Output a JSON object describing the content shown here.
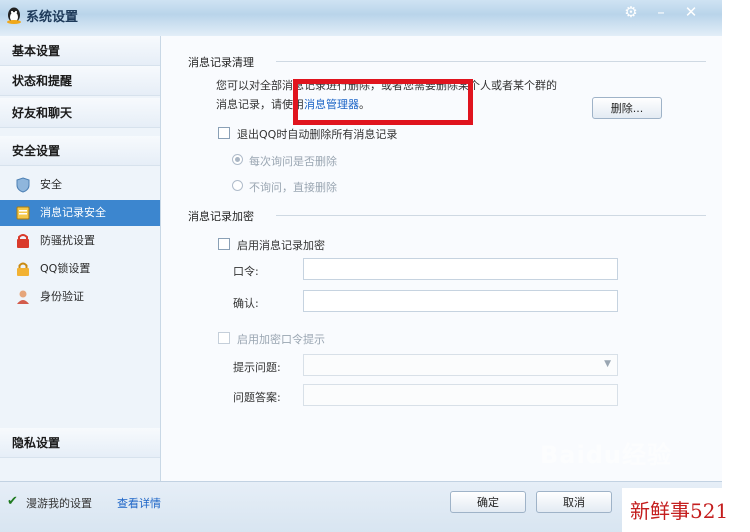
{
  "window": {
    "title": "系统设置",
    "controls": [
      "gear-icon",
      "minimize-icon",
      "close-icon"
    ]
  },
  "sidebar": {
    "categories": [
      {
        "label": "基本设置"
      },
      {
        "label": "状态和提醒"
      },
      {
        "label": "好友和聊天"
      },
      {
        "label": "安全设置"
      }
    ],
    "security_items": [
      {
        "label": "安全",
        "icon": "shield-icon"
      },
      {
        "label": "消息记录安全",
        "icon": "message-record-icon",
        "selected": true
      },
      {
        "label": "防骚扰设置",
        "icon": "anti-harass-icon"
      },
      {
        "label": "QQ锁设置",
        "icon": "lock-icon"
      },
      {
        "label": "身份验证",
        "icon": "user-verify-icon"
      }
    ],
    "privacy": {
      "label": "隐私设置"
    }
  },
  "cleanup": {
    "title": "消息记录清理",
    "desc_line1": "您可以对全部消息记录进行删除，或者您需要删除某个人或者某个群的",
    "desc_line2_prefix": "消息记录，请使用",
    "desc_link": "消息管理器",
    "desc_line2_suffix": "。",
    "delete_button": "删除...",
    "auto_delete_checkbox": {
      "label": "退出QQ时自动删除所有消息记录",
      "checked": false
    },
    "radio_ask": {
      "label": "每次询问是否删除",
      "selected": true
    },
    "radio_direct": {
      "label": "不询问，直接删除",
      "selected": false
    }
  },
  "encrypt": {
    "title": "消息记录加密",
    "enable_checkbox": {
      "label": "启用消息记录加密",
      "checked": false
    },
    "password_label": "口令:",
    "password_value": "",
    "confirm_label": "确认:",
    "confirm_value": "",
    "hint_checkbox": {
      "label": "启用加密口令提示",
      "checked": false
    },
    "question_label": "提示问题:",
    "question_value": "",
    "answer_label": "问题答案:",
    "answer_value": ""
  },
  "footer": {
    "sync_checkbox": {
      "label": "漫游我的设置",
      "checked": true
    },
    "sync_link": "查看详情",
    "ok_button": "确定",
    "cancel_button": "取消"
  },
  "watermark": "Baidu经验",
  "corner_tag": "新鲜事521",
  "colors": {
    "highlight_box": "#e0141e",
    "selected_item": "#3c86cf",
    "link": "#1a63c6"
  }
}
